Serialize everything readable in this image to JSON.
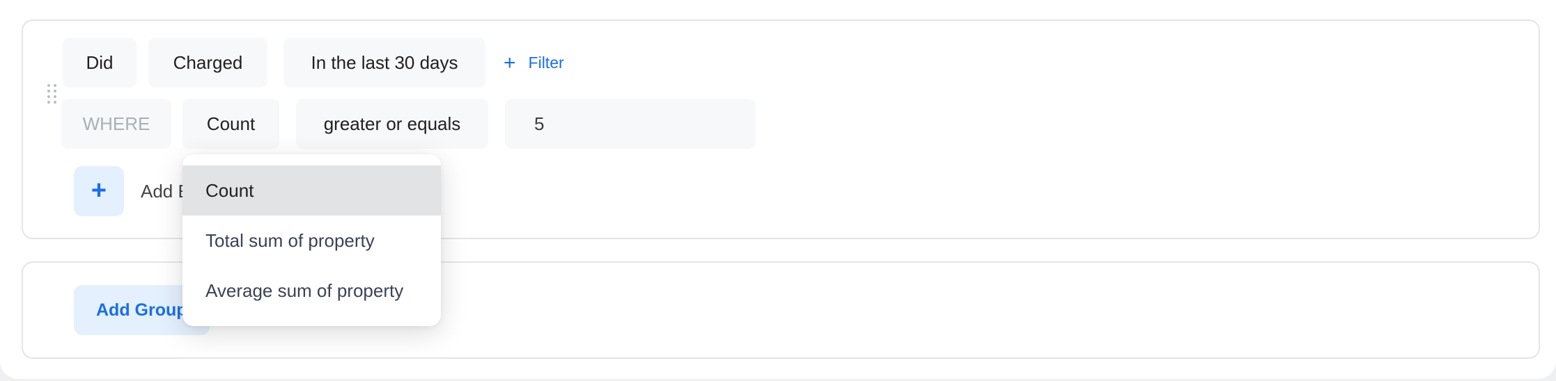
{
  "condition_group": {
    "row1": {
      "verb": "Did",
      "event": "Charged",
      "timeframe": "In the last 30 days",
      "filter_link": "Filter",
      "filter_icon": "plus-icon"
    },
    "row2": {
      "where_label": "WHERE",
      "aggregate": "Count",
      "operator": "greater or equals",
      "value": "5"
    },
    "add_button_icon": "plus-icon",
    "add_label": "Add Event",
    "drag_handle_icon": "drag-handle-icon"
  },
  "aggregate_dropdown": {
    "selected": "Count",
    "options": [
      {
        "label": "Count"
      },
      {
        "label": "Total sum of property"
      },
      {
        "label": "Average sum of property"
      }
    ]
  },
  "groups": {
    "add_group_label": "Add Group"
  },
  "colors": {
    "accent": "#1a6fe6",
    "accent_bg": "#e5f0fe",
    "chip_bg": "#f7f8fa",
    "selected_option_bg": "#e2e3e5",
    "border": "#e4e5e7"
  }
}
